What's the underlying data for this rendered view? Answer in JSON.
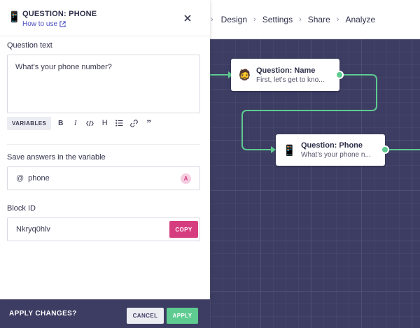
{
  "nav": {
    "items": [
      "Design",
      "Settings",
      "Share",
      "Analyze"
    ],
    "separator": "›"
  },
  "panel": {
    "icon": "📱",
    "title": "QUESTION: PHONE",
    "how_to_use": "How to use",
    "question_label": "Question text",
    "question_value": "What's your phone number?",
    "variables_label": "VARIABLES",
    "format_icons": [
      "bold-icon",
      "italic-icon",
      "code-icon",
      "heading-icon",
      "list-icon",
      "link-icon",
      "quote-icon"
    ],
    "save_label": "Save answers in the variable",
    "variable_prefix": "@",
    "variable_value": "phone",
    "variable_badge": "A",
    "block_id_label": "Block ID",
    "block_id_value": "Nkryq0hlv",
    "copy_label": "COPY"
  },
  "footer": {
    "label": "APPLY CHANGES?",
    "cancel": "CANCEL",
    "apply": "APPLY"
  },
  "flow": {
    "nodes": [
      {
        "icon": "🧔",
        "title": "Question: Name",
        "subtitle": "First, let's get to kno..."
      },
      {
        "icon": "📱",
        "title": "Question: Phone",
        "subtitle": "What's your phone n..."
      }
    ]
  },
  "colors": {
    "accent_pink": "#d63d7f",
    "accent_green": "#5ecb90",
    "canvas": "#3d3d63",
    "link": "#4b4fc4"
  }
}
